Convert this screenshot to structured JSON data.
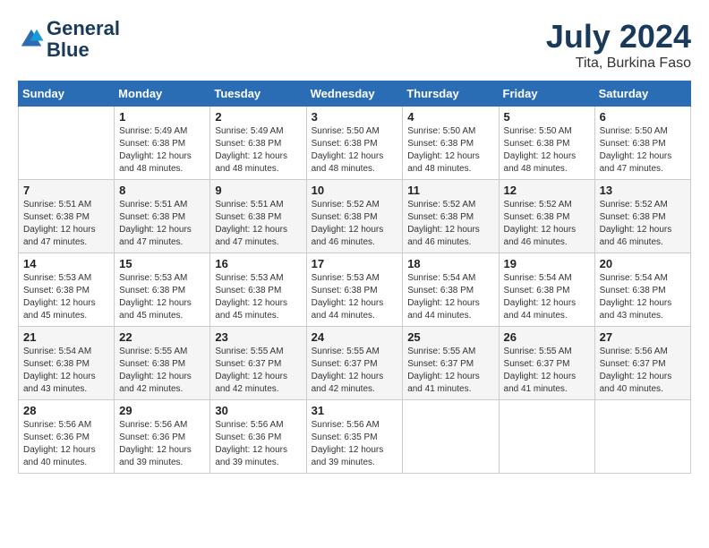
{
  "logo": {
    "line1": "General",
    "line2": "Blue"
  },
  "title": "July 2024",
  "subtitle": "Tita, Burkina Faso",
  "header_days": [
    "Sunday",
    "Monday",
    "Tuesday",
    "Wednesday",
    "Thursday",
    "Friday",
    "Saturday"
  ],
  "weeks": [
    [
      {
        "day": "",
        "sunrise": "",
        "sunset": "",
        "daylight": ""
      },
      {
        "day": "1",
        "sunrise": "Sunrise: 5:49 AM",
        "sunset": "Sunset: 6:38 PM",
        "daylight": "Daylight: 12 hours and 48 minutes."
      },
      {
        "day": "2",
        "sunrise": "Sunrise: 5:49 AM",
        "sunset": "Sunset: 6:38 PM",
        "daylight": "Daylight: 12 hours and 48 minutes."
      },
      {
        "day": "3",
        "sunrise": "Sunrise: 5:50 AM",
        "sunset": "Sunset: 6:38 PM",
        "daylight": "Daylight: 12 hours and 48 minutes."
      },
      {
        "day": "4",
        "sunrise": "Sunrise: 5:50 AM",
        "sunset": "Sunset: 6:38 PM",
        "daylight": "Daylight: 12 hours and 48 minutes."
      },
      {
        "day": "5",
        "sunrise": "Sunrise: 5:50 AM",
        "sunset": "Sunset: 6:38 PM",
        "daylight": "Daylight: 12 hours and 48 minutes."
      },
      {
        "day": "6",
        "sunrise": "Sunrise: 5:50 AM",
        "sunset": "Sunset: 6:38 PM",
        "daylight": "Daylight: 12 hours and 47 minutes."
      }
    ],
    [
      {
        "day": "7",
        "sunrise": "Sunrise: 5:51 AM",
        "sunset": "Sunset: 6:38 PM",
        "daylight": "Daylight: 12 hours and 47 minutes."
      },
      {
        "day": "8",
        "sunrise": "Sunrise: 5:51 AM",
        "sunset": "Sunset: 6:38 PM",
        "daylight": "Daylight: 12 hours and 47 minutes."
      },
      {
        "day": "9",
        "sunrise": "Sunrise: 5:51 AM",
        "sunset": "Sunset: 6:38 PM",
        "daylight": "Daylight: 12 hours and 47 minutes."
      },
      {
        "day": "10",
        "sunrise": "Sunrise: 5:52 AM",
        "sunset": "Sunset: 6:38 PM",
        "daylight": "Daylight: 12 hours and 46 minutes."
      },
      {
        "day": "11",
        "sunrise": "Sunrise: 5:52 AM",
        "sunset": "Sunset: 6:38 PM",
        "daylight": "Daylight: 12 hours and 46 minutes."
      },
      {
        "day": "12",
        "sunrise": "Sunrise: 5:52 AM",
        "sunset": "Sunset: 6:38 PM",
        "daylight": "Daylight: 12 hours and 46 minutes."
      },
      {
        "day": "13",
        "sunrise": "Sunrise: 5:52 AM",
        "sunset": "Sunset: 6:38 PM",
        "daylight": "Daylight: 12 hours and 46 minutes."
      }
    ],
    [
      {
        "day": "14",
        "sunrise": "Sunrise: 5:53 AM",
        "sunset": "Sunset: 6:38 PM",
        "daylight": "Daylight: 12 hours and 45 minutes."
      },
      {
        "day": "15",
        "sunrise": "Sunrise: 5:53 AM",
        "sunset": "Sunset: 6:38 PM",
        "daylight": "Daylight: 12 hours and 45 minutes."
      },
      {
        "day": "16",
        "sunrise": "Sunrise: 5:53 AM",
        "sunset": "Sunset: 6:38 PM",
        "daylight": "Daylight: 12 hours and 45 minutes."
      },
      {
        "day": "17",
        "sunrise": "Sunrise: 5:53 AM",
        "sunset": "Sunset: 6:38 PM",
        "daylight": "Daylight: 12 hours and 44 minutes."
      },
      {
        "day": "18",
        "sunrise": "Sunrise: 5:54 AM",
        "sunset": "Sunset: 6:38 PM",
        "daylight": "Daylight: 12 hours and 44 minutes."
      },
      {
        "day": "19",
        "sunrise": "Sunrise: 5:54 AM",
        "sunset": "Sunset: 6:38 PM",
        "daylight": "Daylight: 12 hours and 44 minutes."
      },
      {
        "day": "20",
        "sunrise": "Sunrise: 5:54 AM",
        "sunset": "Sunset: 6:38 PM",
        "daylight": "Daylight: 12 hours and 43 minutes."
      }
    ],
    [
      {
        "day": "21",
        "sunrise": "Sunrise: 5:54 AM",
        "sunset": "Sunset: 6:38 PM",
        "daylight": "Daylight: 12 hours and 43 minutes."
      },
      {
        "day": "22",
        "sunrise": "Sunrise: 5:55 AM",
        "sunset": "Sunset: 6:38 PM",
        "daylight": "Daylight: 12 hours and 42 minutes."
      },
      {
        "day": "23",
        "sunrise": "Sunrise: 5:55 AM",
        "sunset": "Sunset: 6:37 PM",
        "daylight": "Daylight: 12 hours and 42 minutes."
      },
      {
        "day": "24",
        "sunrise": "Sunrise: 5:55 AM",
        "sunset": "Sunset: 6:37 PM",
        "daylight": "Daylight: 12 hours and 42 minutes."
      },
      {
        "day": "25",
        "sunrise": "Sunrise: 5:55 AM",
        "sunset": "Sunset: 6:37 PM",
        "daylight": "Daylight: 12 hours and 41 minutes."
      },
      {
        "day": "26",
        "sunrise": "Sunrise: 5:55 AM",
        "sunset": "Sunset: 6:37 PM",
        "daylight": "Daylight: 12 hours and 41 minutes."
      },
      {
        "day": "27",
        "sunrise": "Sunrise: 5:56 AM",
        "sunset": "Sunset: 6:37 PM",
        "daylight": "Daylight: 12 hours and 40 minutes."
      }
    ],
    [
      {
        "day": "28",
        "sunrise": "Sunrise: 5:56 AM",
        "sunset": "Sunset: 6:36 PM",
        "daylight": "Daylight: 12 hours and 40 minutes."
      },
      {
        "day": "29",
        "sunrise": "Sunrise: 5:56 AM",
        "sunset": "Sunset: 6:36 PM",
        "daylight": "Daylight: 12 hours and 39 minutes."
      },
      {
        "day": "30",
        "sunrise": "Sunrise: 5:56 AM",
        "sunset": "Sunset: 6:36 PM",
        "daylight": "Daylight: 12 hours and 39 minutes."
      },
      {
        "day": "31",
        "sunrise": "Sunrise: 5:56 AM",
        "sunset": "Sunset: 6:35 PM",
        "daylight": "Daylight: 12 hours and 39 minutes."
      },
      {
        "day": "",
        "sunrise": "",
        "sunset": "",
        "daylight": ""
      },
      {
        "day": "",
        "sunrise": "",
        "sunset": "",
        "daylight": ""
      },
      {
        "day": "",
        "sunrise": "",
        "sunset": "",
        "daylight": ""
      }
    ]
  ]
}
